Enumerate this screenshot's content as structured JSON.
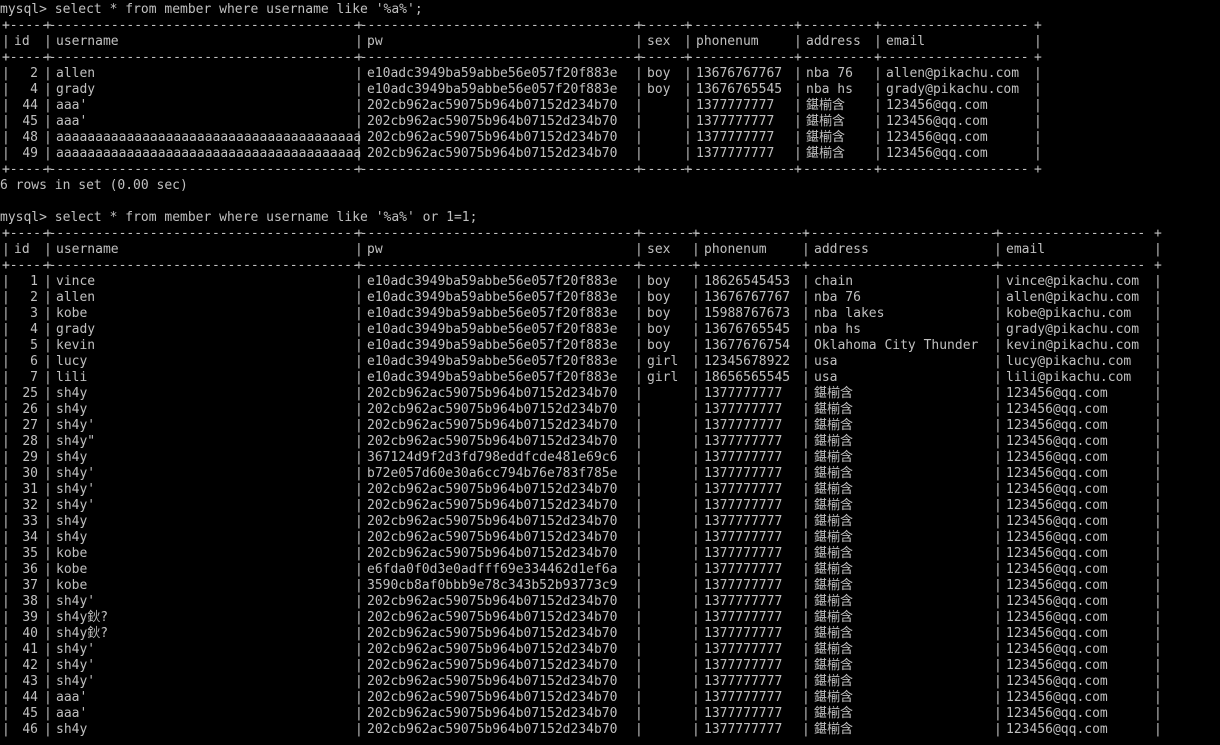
{
  "prompt": "mysql>",
  "query1": {
    "sql": "select * from member where username like '%a%';",
    "columns": [
      "id",
      "username",
      "pw",
      "sex",
      "phonenum",
      "address",
      "email"
    ],
    "rows": [
      [
        "2",
        "allen",
        "e10adc3949ba59abbe56e057f20f883e",
        "boy",
        "13676767767",
        "nba 76",
        "allen@pikachu.com"
      ],
      [
        "4",
        "grady",
        "e10adc3949ba59abbe56e057f20f883e",
        "boy",
        "13676765545",
        "nba hs",
        "grady@pikachu.com"
      ],
      [
        "44",
        "aaa'",
        "202cb962ac59075b964b07152d234b70",
        "",
        "1377777777",
        "鍖椾含",
        "123456@qq.com"
      ],
      [
        "45",
        "aaa'",
        "202cb962ac59075b964b07152d234b70",
        "",
        "1377777777",
        "鍖椾含",
        "123456@qq.com"
      ],
      [
        "48",
        "aaaaaaaaaaaaaaaaaaaaaaaaaaaaaaaaaaaaaaa",
        "202cb962ac59075b964b07152d234b70",
        "",
        "1377777777",
        "鍖椾含",
        "123456@qq.com"
      ],
      [
        "49",
        "aaaaaaaaaaaaaaaaaaaaaaaaaaaaaaaaaaaaaaa",
        "202cb962ac59075b964b07152d234b70",
        "",
        "1377777777",
        "鍖椾含",
        "123456@qq.com"
      ]
    ],
    "result": "6 rows in set (0.00 sec)"
  },
  "query2": {
    "sql": "select * from member where username like '%a%' or 1=1;",
    "columns": [
      "id",
      "username",
      "pw",
      "sex",
      "phonenum",
      "address",
      "email"
    ],
    "rows": [
      [
        "1",
        "vince",
        "e10adc3949ba59abbe56e057f20f883e",
        "boy",
        "18626545453",
        "chain",
        "vince@pikachu.com"
      ],
      [
        "2",
        "allen",
        "e10adc3949ba59abbe56e057f20f883e",
        "boy",
        "13676767767",
        "nba 76",
        "allen@pikachu.com"
      ],
      [
        "3",
        "kobe",
        "e10adc3949ba59abbe56e057f20f883e",
        "boy",
        "15988767673",
        "nba lakes",
        "kobe@pikachu.com"
      ],
      [
        "4",
        "grady",
        "e10adc3949ba59abbe56e057f20f883e",
        "boy",
        "13676765545",
        "nba hs",
        "grady@pikachu.com"
      ],
      [
        "5",
        "kevin",
        "e10adc3949ba59abbe56e057f20f883e",
        "boy",
        "13677676754",
        "Oklahoma City Thunder",
        "kevin@pikachu.com"
      ],
      [
        "6",
        "lucy",
        "e10adc3949ba59abbe56e057f20f883e",
        "girl",
        "12345678922",
        "usa",
        "lucy@pikachu.com"
      ],
      [
        "7",
        "lili",
        "e10adc3949ba59abbe56e057f20f883e",
        "girl",
        "18656565545",
        "usa",
        "lili@pikachu.com"
      ],
      [
        "25",
        "sh4y",
        "202cb962ac59075b964b07152d234b70",
        "",
        "1377777777",
        "鍖椾含",
        "123456@qq.com"
      ],
      [
        "26",
        "sh4y",
        "202cb962ac59075b964b07152d234b70",
        "",
        "1377777777",
        "鍖椾含",
        "123456@qq.com"
      ],
      [
        "27",
        "sh4y'",
        "202cb962ac59075b964b07152d234b70",
        "",
        "1377777777",
        "鍖椾含",
        "123456@qq.com"
      ],
      [
        "28",
        "sh4y\"",
        "202cb962ac59075b964b07152d234b70",
        "",
        "1377777777",
        "鍖椾含",
        "123456@qq.com"
      ],
      [
        "29",
        "sh4y",
        "367124d9f2d3fd798eddfcde481e69c6",
        "",
        "1377777777",
        "鍖椾含",
        "123456@qq.com"
      ],
      [
        "30",
        "sh4y'",
        "b72e057d60e30a6cc794b76e783f785e",
        "",
        "1377777777",
        "鍖椾含",
        "123456@qq.com"
      ],
      [
        "31",
        "sh4y'",
        "202cb962ac59075b964b07152d234b70",
        "",
        "1377777777",
        "鍖椾含",
        "123456@qq.com"
      ],
      [
        "32",
        "sh4y'",
        "202cb962ac59075b964b07152d234b70",
        "",
        "1377777777",
        "鍖椾含",
        "123456@qq.com"
      ],
      [
        "33",
        "sh4y",
        "202cb962ac59075b964b07152d234b70",
        "",
        "1377777777",
        "鍖椾含",
        "123456@qq.com"
      ],
      [
        "34",
        "sh4y",
        "202cb962ac59075b964b07152d234b70",
        "",
        "1377777777",
        "鍖椾含",
        "123456@qq.com"
      ],
      [
        "35",
        "kobe",
        "202cb962ac59075b964b07152d234b70",
        "",
        "1377777777",
        "鍖椾含",
        "123456@qq.com"
      ],
      [
        "36",
        "kobe",
        "e6fda0f0d3e0adfff69e334462d1ef6a",
        "",
        "1377777777",
        "鍖椾含",
        "123456@qq.com"
      ],
      [
        "37",
        "kobe",
        "3590cb8af0bbb9e78c343b52b93773c9",
        "",
        "1377777777",
        "鍖椾含",
        "123456@qq.com"
      ],
      [
        "38",
        "sh4y'",
        "202cb962ac59075b964b07152d234b70",
        "",
        "1377777777",
        "鍖椾含",
        "123456@qq.com"
      ],
      [
        "39",
        "sh4y鈥?",
        "202cb962ac59075b964b07152d234b70",
        "",
        "1377777777",
        "鍖椾含",
        "123456@qq.com"
      ],
      [
        "40",
        "sh4y鈥?",
        "202cb962ac59075b964b07152d234b70",
        "",
        "1377777777",
        "鍖椾含",
        "123456@qq.com"
      ],
      [
        "41",
        "sh4y'",
        "202cb962ac59075b964b07152d234b70",
        "",
        "1377777777",
        "鍖椾含",
        "123456@qq.com"
      ],
      [
        "42",
        "sh4y'",
        "202cb962ac59075b964b07152d234b70",
        "",
        "1377777777",
        "鍖椾含",
        "123456@qq.com"
      ],
      [
        "43",
        "sh4y'",
        "202cb962ac59075b964b07152d234b70",
        "",
        "1377777777",
        "鍖椾含",
        "123456@qq.com"
      ],
      [
        "44",
        "aaa'",
        "202cb962ac59075b964b07152d234b70",
        "",
        "1377777777",
        "鍖椾含",
        "123456@qq.com"
      ],
      [
        "45",
        "aaa'",
        "202cb962ac59075b964b07152d234b70",
        "",
        "1377777777",
        "鍖椾含",
        "123456@qq.com"
      ],
      [
        "46",
        "sh4y",
        "202cb962ac59075b964b07152d234b70",
        "",
        "1377777777",
        "鍖椾含",
        "123456@qq.com"
      ]
    ]
  }
}
